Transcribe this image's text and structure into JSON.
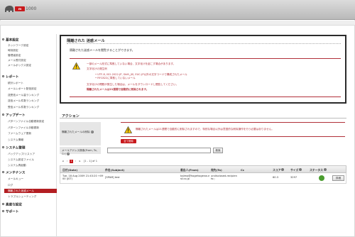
{
  "header": {
    "brand_badge": "m",
    "product": "1000"
  },
  "sidebar": {
    "sections": [
      {
        "label": "基本設定",
        "items": [
          "ネットワーク設定",
          "時刻設定",
          "管理者設定",
          "メール受付設定",
          "メールボックス設定"
        ]
      },
      {
        "label": "レポート",
        "items": [
          "統計レポート",
          "メールレポート配信設定",
          "送受信メール量ランキング",
          "送信メール件数ランキング",
          "受信メール件数ランキング"
        ]
      },
      {
        "label": "アップデート",
        "items": [
          "パターンファイル自動更新設定",
          "パターンファイル手動更新",
          "ファームウェア更新",
          "システム情報"
        ]
      },
      {
        "label": "システム管理",
        "items": [
          "バックアップ/リストア",
          "システム設定ファイル",
          "システム再起動"
        ]
      },
      {
        "label": "メンテナンス",
        "items": [
          "メールキュー",
          "ログ",
          "隔離された迷惑メール",
          "トラブルシューティング"
        ]
      },
      {
        "label": "高度な設定",
        "items": []
      },
      {
        "label": "サポート",
        "items": []
      }
    ],
    "active_item": "隔離された迷惑メール"
  },
  "panel": {
    "title": "隔離された 迷惑メール",
    "description": "隔離された迷惑メールを閲覧することができます。",
    "warning_lines": [
      "一部のメール形式に準拠していない場合、文字化けを起こす場合があります。",
      "文字化けの発生例",
      "UTF-8, ISO-2022-JP, Shift_JIS, EUC-JP以外の文字コードで構成されたメール",
      "RFC822に準拠していないメール",
      "文字化けの問題が発生した場合は、メールをダウンロードし閲覧してください。",
      "隔離されたメールは21週間で自動的に削除されます。"
    ]
  },
  "action": {
    "title": "アクション",
    "delete_label": "隔離されたメールの削除",
    "delete_warning": "隔離されたメールは21週間で自動的に削除されますので、特別な場合以外は意図的な削除操作を行う必要はありません。",
    "delete_button": "全て削除",
    "search_label": "メールアドレス検索(From, To, Cc)",
    "search_value": "",
    "search_button": "検索"
  },
  "pager": {
    "current": "1",
    "info": "[1 - 1] of 1"
  },
  "table": {
    "headers": [
      "日付(Date)",
      "件名(Subject)",
      "差出人(From)",
      "宛先(To)",
      "Cc",
      "スコア",
      "サイズ",
      "ステータス"
    ],
    "rows": [
      {
        "date_line1": "Tue, 18 Aug 2009 21:43:20 +09",
        "date_line2": "00 (JST)",
        "subject": "[SPAM] test",
        "from_line1": "tajimo@hogehogenoumeg@localho",
        "from_line2": "st.co.jp",
        "to_line1": "undisclosed-recipien",
        "to_line2": "ts:;",
        "cc": "",
        "score": "60.3",
        "size": "3297",
        "detail_button": "詳細"
      }
    ]
  },
  "colors": {
    "brand_red": "#c8191c",
    "warning_red": "#b1303a",
    "status_ok": "#4a9d2f"
  }
}
